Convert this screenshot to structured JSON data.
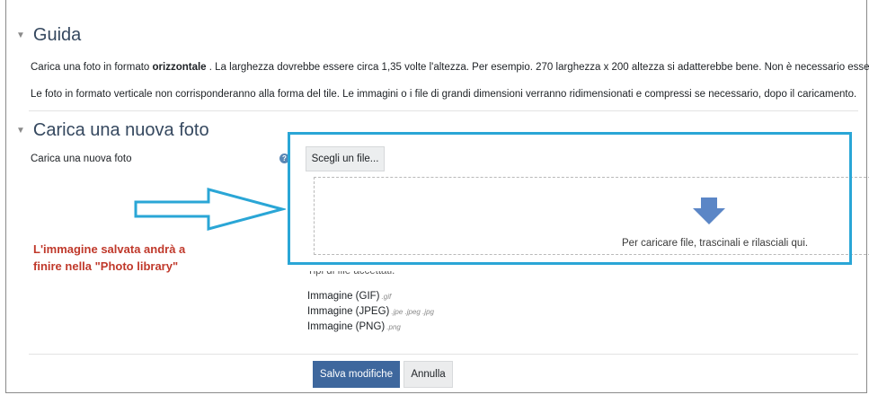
{
  "guide": {
    "title": "Guida",
    "line1_pre": "Carica una foto in formato ",
    "line1_bold": "orizzontale",
    "line1_post": " . La larghezza dovrebbe essere circa 1,35 volte l'altezza. Per esempio. 270 larghezza x 200 altezza si adatterebbe bene. Non è necessario essere esatti.",
    "line2": "Le foto in formato verticale non corrisponderanno alla forma del tile. Le immagini o i file di grandi dimensioni verranno ridimensionati e compressi se necessario, dopo il caricamento."
  },
  "upload": {
    "section_title": "Carica una nuova foto",
    "field_label": "Carica una nuova foto",
    "help_icon": "question-circle-icon",
    "choose_button": "Scegli un file...",
    "dropzone_text": "Per caricare file, trascinali e rilasciali qui.",
    "accepted_caption": "Tipi di file accettati:",
    "types": [
      {
        "name": "Immagine (GIF)",
        "ext": ".gif"
      },
      {
        "name": "Immagine (JPEG)",
        "ext": ".jpe .jpeg .jpg"
      },
      {
        "name": "Immagine (PNG)",
        "ext": ".png"
      }
    ]
  },
  "annotation": {
    "line1": "L'immagine salvata andrà a",
    "line2": "finire nella \"Photo library\"",
    "color": "#c0392b",
    "highlight_color": "#2aa6d6"
  },
  "actions": {
    "save": "Salva modifiche",
    "cancel": "Annulla"
  },
  "colors": {
    "primary": "#3e679d",
    "heading": "#35485f"
  }
}
